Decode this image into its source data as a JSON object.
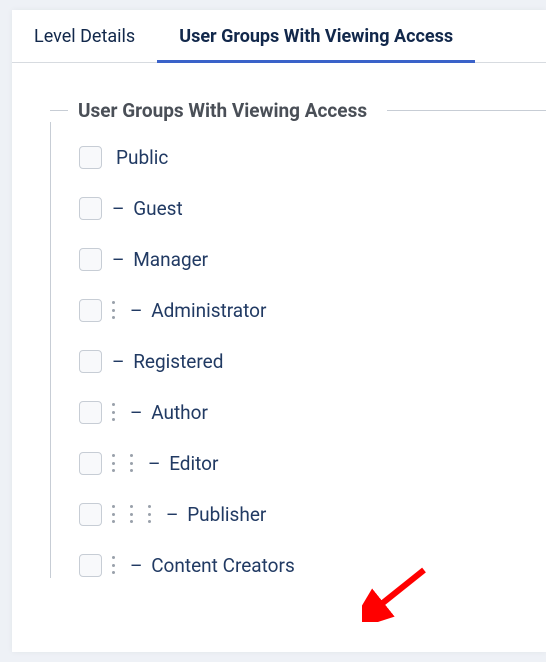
{
  "tabs": {
    "level_details": "Level Details",
    "viewing_access": "User Groups With Viewing Access"
  },
  "fieldset": {
    "legend": "User Groups With Viewing Access"
  },
  "groups": {
    "g0": {
      "dash": "",
      "name": "Public"
    },
    "g1": {
      "dash": "– ",
      "name": "Guest"
    },
    "g2": {
      "dash": "– ",
      "name": "Manager"
    },
    "g3": {
      "dash": "– ",
      "name": "Administrator"
    },
    "g4": {
      "dash": "– ",
      "name": "Registered"
    },
    "g5": {
      "dash": "– ",
      "name": "Author"
    },
    "g6": {
      "dash": "– ",
      "name": "Editor"
    },
    "g7": {
      "dash": "– ",
      "name": "Publisher"
    },
    "g8": {
      "dash": "– ",
      "name": "Content Creators"
    }
  },
  "colors": {
    "accent": "#3a62c9",
    "text": "#213a63",
    "arrow": "#ff0000"
  }
}
